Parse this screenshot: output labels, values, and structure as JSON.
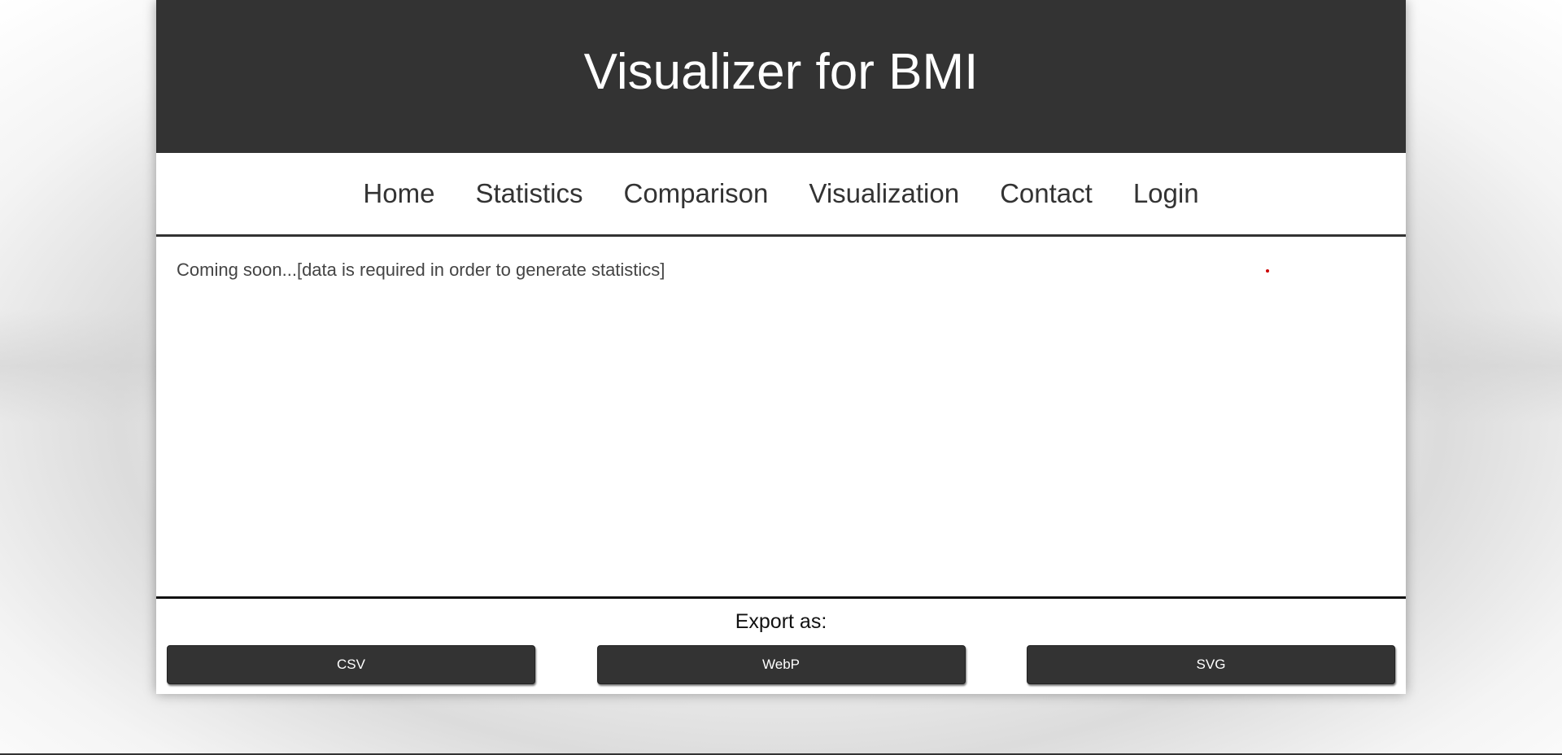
{
  "header": {
    "title": "Visualizer for BMI"
  },
  "nav": {
    "items": [
      {
        "label": "Home"
      },
      {
        "label": "Statistics"
      },
      {
        "label": "Comparison"
      },
      {
        "label": "Visualization"
      },
      {
        "label": "Contact"
      },
      {
        "label": "Login"
      }
    ]
  },
  "content": {
    "message": "Coming soon...[data is required in order to generate statistics]"
  },
  "export": {
    "label": "Export as:",
    "buttons": [
      {
        "label": "CSV"
      },
      {
        "label": "WebP"
      },
      {
        "label": "SVG"
      }
    ]
  },
  "colors": {
    "header_bg": "#333333",
    "button_bg": "#333333",
    "dot": "#cc0000"
  }
}
